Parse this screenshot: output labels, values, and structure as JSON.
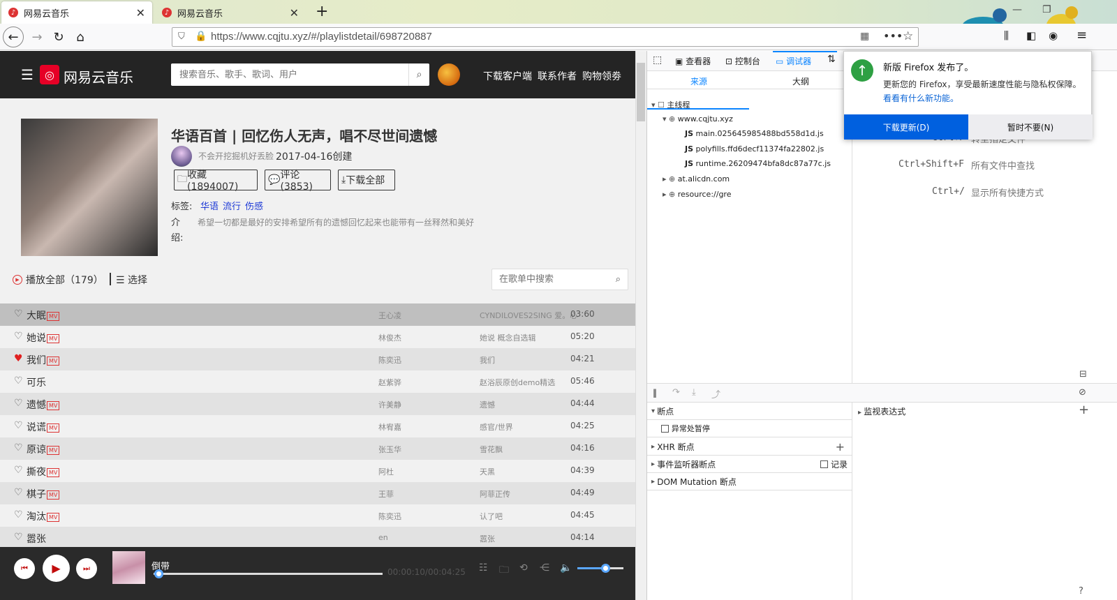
{
  "browser": {
    "tabs": [
      {
        "title": "网易云音乐"
      },
      {
        "title": "网易云音乐"
      }
    ],
    "url": "https://www.cqjtu.xyz/#/playlistdetail/698720887"
  },
  "site": {
    "brand": "网易云音乐",
    "search_placeholder": "搜索音乐、歌手、歌词、用户",
    "links": [
      "下载客户端",
      "联系作者",
      "购物领劵"
    ]
  },
  "playlist": {
    "title": "华语百首 | 回忆伤人无声，唱不尽世间遗憾",
    "creator": "不会开挖掘机好丢脸",
    "created": "2017-04-16创建",
    "collect": "收藏(1894007)",
    "comment": "评论(3853)",
    "download": "下载全部",
    "tags_label": "标签:",
    "tags": [
      "华语",
      "流行",
      "伤感"
    ],
    "desc_label": "介绍:",
    "desc": "希望一切都是最好的安排希望所有的遗憾回忆起来也能带有一丝释然和美好",
    "play_all": "播放全部",
    "count": "（179）",
    "select": "选择",
    "search_placeholder": "在歌单中搜索"
  },
  "songs": [
    {
      "name": "大眠",
      "mv": true,
      "liked": false,
      "artist": "王心凌",
      "album": "CYNDILOVES2SING 爱。心凌",
      "duration": "03:60"
    },
    {
      "name": "她说",
      "mv": true,
      "liked": false,
      "artist": "林俊杰",
      "album": "她说 概念自选辑",
      "duration": "05:20"
    },
    {
      "name": "我们",
      "mv": true,
      "liked": true,
      "artist": "陈奕迅",
      "album": "我们",
      "duration": "04:21"
    },
    {
      "name": "可乐",
      "mv": false,
      "liked": false,
      "artist": "赵紫骅",
      "album": "赵浴辰原创demo精选",
      "duration": "05:46"
    },
    {
      "name": "遗憾",
      "mv": true,
      "liked": false,
      "artist": "许美静",
      "album": "遗憾",
      "duration": "04:44"
    },
    {
      "name": "说谎",
      "mv": true,
      "liked": false,
      "artist": "林宥嘉",
      "album": "感官/世界",
      "duration": "04:25"
    },
    {
      "name": "原谅",
      "mv": true,
      "liked": false,
      "artist": "张玉华",
      "album": "雪花飘",
      "duration": "04:16"
    },
    {
      "name": "撕夜",
      "mv": true,
      "liked": false,
      "artist": "阿杜",
      "album": "天黑",
      "duration": "04:39"
    },
    {
      "name": "棋子",
      "mv": true,
      "liked": false,
      "artist": "王菲",
      "album": "阿菲正传",
      "duration": "04:49"
    },
    {
      "name": "淘汰",
      "mv": true,
      "liked": false,
      "artist": "陈奕迅",
      "album": "认了吧",
      "duration": "04:45"
    },
    {
      "name": "嚣张",
      "mv": false,
      "liked": false,
      "artist": "en",
      "album": "嚣张",
      "duration": "04:14"
    }
  ],
  "mv_label": "MV",
  "player": {
    "title": "倒带",
    "time": "00:00:10/00:04:25",
    "progress": 0.02,
    "volume": 0.6
  },
  "devtools": {
    "tabs": [
      "查看器",
      "控制台",
      "调试器"
    ],
    "active_tab": "调试器",
    "source_tabs": [
      "来源",
      "大纲"
    ],
    "tree": {
      "main_thread": "主线程",
      "host": "www.cqjtu.xyz",
      "files": [
        "main.025645985488bd558d1d.js",
        "polyfills.ffd6decf11374fa22802.js",
        "runtime.26209474bfa8dc87a77c.js"
      ],
      "other_hosts": [
        "at.alicdn.com",
        "resource://gre"
      ],
      "js_label": "JS"
    },
    "shortcuts": [
      {
        "key": "Ctrl+P",
        "desc": "转至指定文件"
      },
      {
        "key": "Ctrl+Shift+F",
        "desc": "所有文件中查找"
      },
      {
        "key": "Ctrl+/",
        "desc": "显示所有快捷方式"
      }
    ],
    "breakpoints": "断点",
    "pause_on_exceptions": "异常处暂停",
    "xhr": "XHR 断点",
    "event_listeners": "事件监听器断点",
    "record": "记录",
    "dom_mutation": "DOM Mutation 断点",
    "watch": "监视表达式"
  },
  "notification": {
    "title": "新版 Firefox 发布了。",
    "text": "更新您的 Firefox，享受最新速度性能与隐私权保障。",
    "link": "看看有什么新功能。",
    "download": "下载更新(D)",
    "later": "暂时不要(N)"
  }
}
